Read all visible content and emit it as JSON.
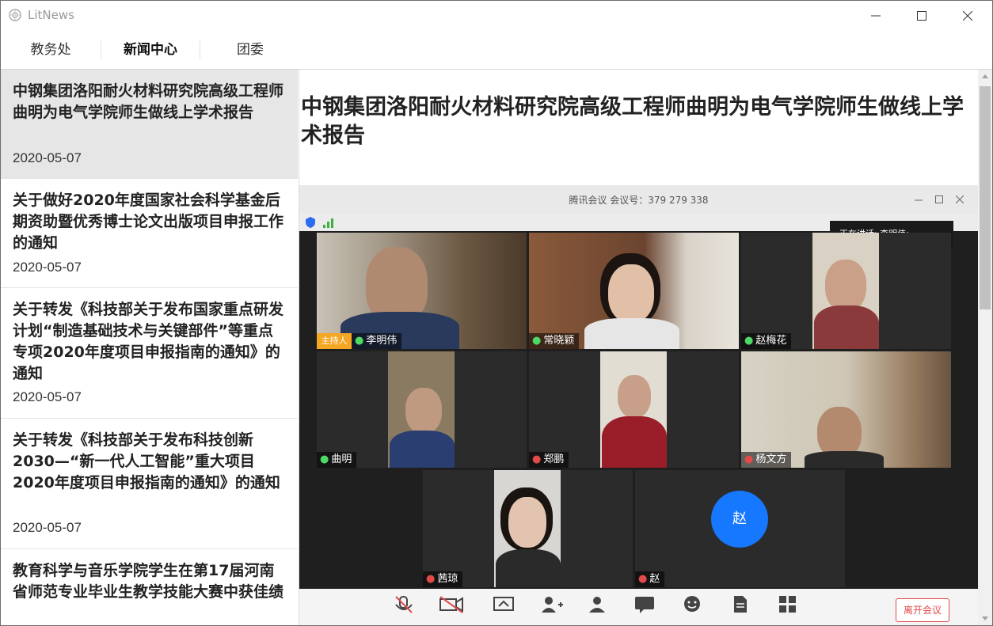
{
  "window": {
    "title": "LitNews",
    "controls": {
      "minimize": "minimize-icon",
      "maximize": "maximize-icon",
      "close": "close-icon"
    }
  },
  "tabs": [
    {
      "label": "教务处",
      "active": false
    },
    {
      "label": "新闻中心",
      "active": true
    },
    {
      "label": "团委",
      "active": false
    }
  ],
  "news_list": [
    {
      "title": "中钢集团洛阳耐火材料研究院高级工程师曲明为电气学院师生做线上学术报告",
      "date": "2020-05-07",
      "selected": true
    },
    {
      "title": "关于做好2020年度国家社会科学基金后期资助暨优秀博士论文出版项目申报工作的通知",
      "date": "2020-05-07",
      "selected": false
    },
    {
      "title": "关于转发《科技部关于发布国家重点研发计划“制造基础技术与关键部件”等重点专项2020年度项目申报指南的通知》的通知",
      "date": "2020-05-07",
      "selected": false
    },
    {
      "title": "关于转发《科技部关于发布科技创新2030—“新一代人工智能”重大项目2020年度项目申报指南的通知》的通知",
      "date": "2020-05-07",
      "selected": false
    },
    {
      "title": "教育科学与音乐学院学生在第17届河南省师范专业毕业生教学技能大赛中获佳绩",
      "date": "",
      "selected": false
    }
  ],
  "article": {
    "title": "中钢集团洛阳耐火材料研究院高级工程师曲明为电气学院师生做线上学术报告"
  },
  "meeting_screenshot": {
    "window_title": "腾讯会议 会议号：379 279 338",
    "speaking_now": "正在讲话: 李明伟;",
    "host_badge": "主持人",
    "participants": [
      {
        "name": "李明伟",
        "muted": false
      },
      {
        "name": "常晓颖",
        "muted": false
      },
      {
        "name": "赵梅花",
        "muted": false
      },
      {
        "name": "曲明",
        "muted": false
      },
      {
        "name": "郑鹏",
        "muted": true
      },
      {
        "name": "杨文方",
        "muted": true
      },
      {
        "name": "茜琼",
        "muted": true
      },
      {
        "name": "赵",
        "muted": true
      }
    ],
    "avatar_initial": "赵",
    "leave_button": "离开会议"
  },
  "colors": {
    "selected_item_bg": "#e6e6e6",
    "meeting_avatar": "#1677ff",
    "host_badge": "#f5a623",
    "leave": "#e24a4a"
  }
}
